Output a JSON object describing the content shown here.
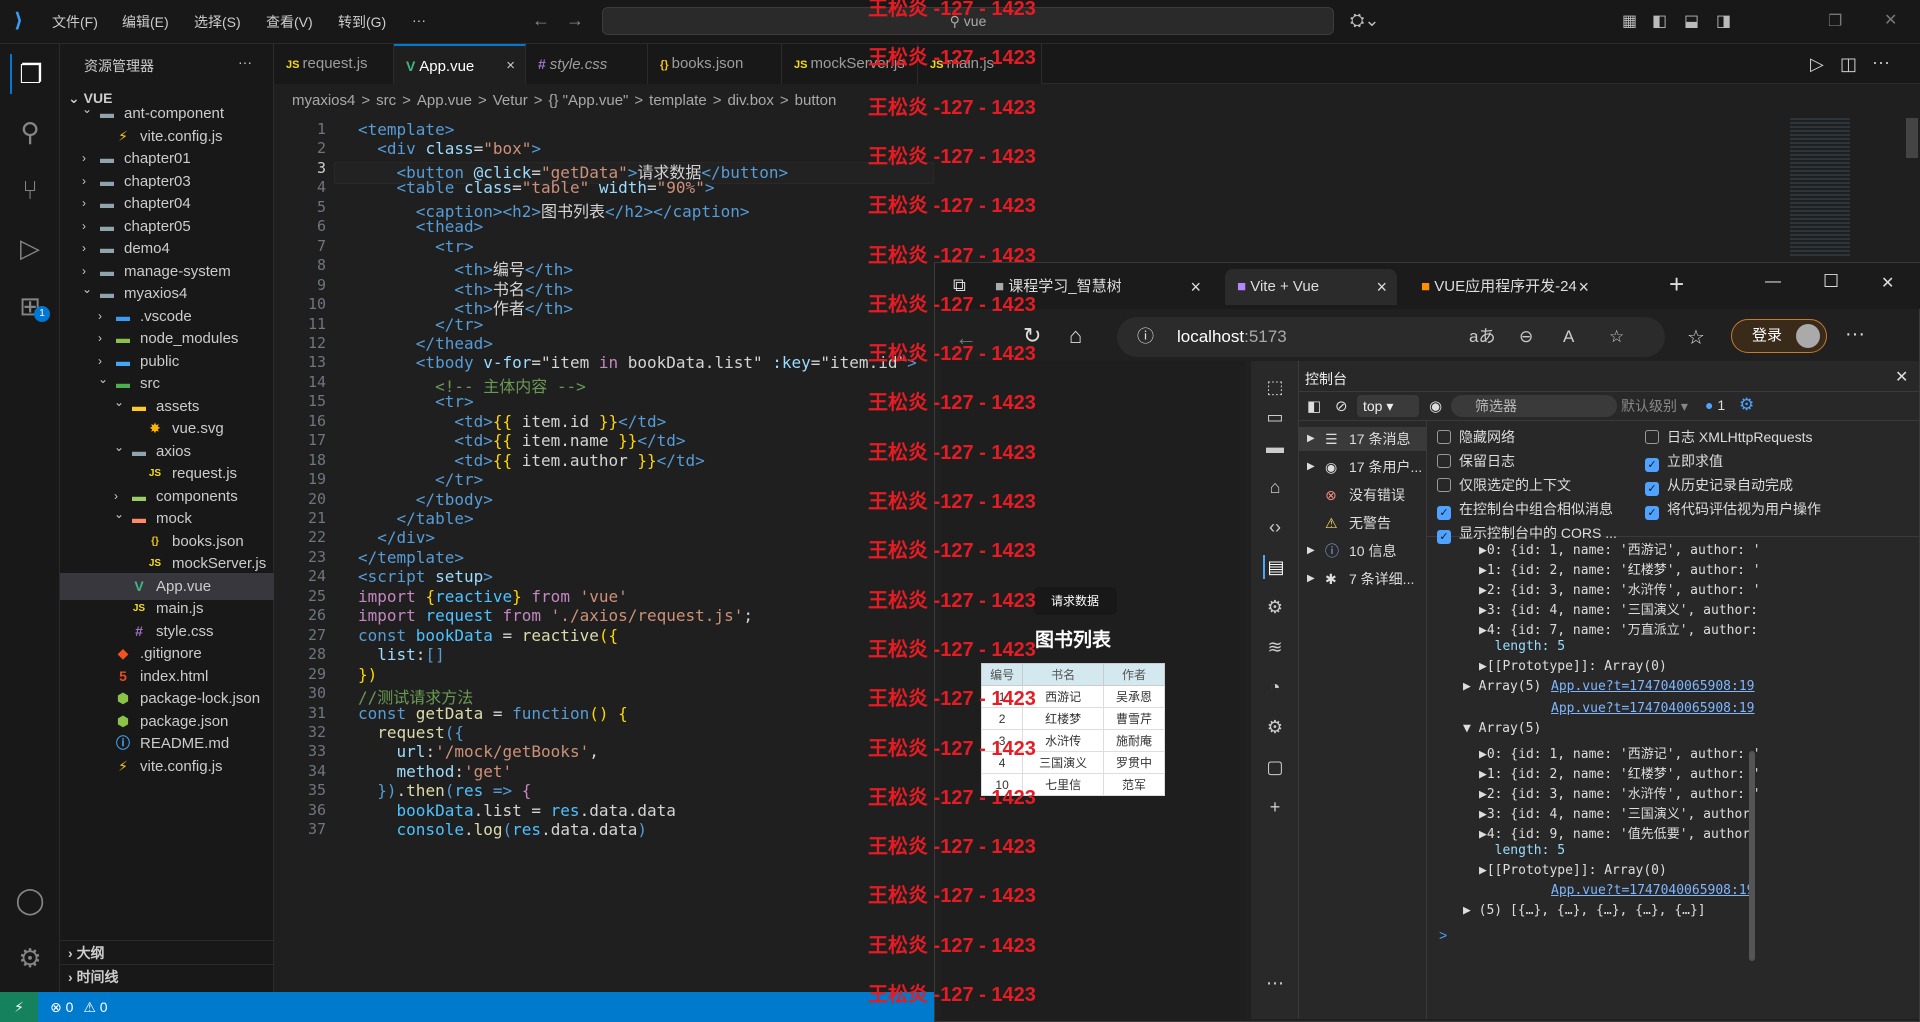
{
  "menu": [
    "文件(F)",
    "编辑(E)",
    "选择(S)",
    "查看(V)",
    "转到(G)",
    "···"
  ],
  "search": "vue",
  "explorer": {
    "title": "资源管理器",
    "more": "···",
    "root": "VUE"
  },
  "tree": [
    {
      "label": "ant-component",
      "depth": 1,
      "type": "folder",
      "open": true,
      "icon": "folder-icon"
    },
    {
      "label": "vite.config.js",
      "depth": 2,
      "type": "file",
      "icon": "vite-file-icon"
    },
    {
      "label": "chapter01",
      "depth": 1,
      "type": "folder",
      "open": false,
      "icon": "folder-icon"
    },
    {
      "label": "chapter03",
      "depth": 1,
      "type": "folder",
      "open": false,
      "icon": "folder-icon"
    },
    {
      "label": "chapter04",
      "depth": 1,
      "type": "folder",
      "open": false,
      "icon": "folder-icon"
    },
    {
      "label": "chapter05",
      "depth": 1,
      "type": "folder",
      "open": false,
      "icon": "folder-icon"
    },
    {
      "label": "demo4",
      "depth": 1,
      "type": "folder",
      "open": false,
      "icon": "folder-icon"
    },
    {
      "label": "manage-system",
      "depth": 1,
      "type": "folder",
      "open": false,
      "icon": "folder-icon"
    },
    {
      "label": "myaxios4",
      "depth": 1,
      "type": "folder",
      "open": true,
      "icon": "folder-icon"
    },
    {
      "label": ".vscode",
      "depth": 2,
      "type": "folder",
      "open": false,
      "icon": "vscode-folder-icon"
    },
    {
      "label": "node_modules",
      "depth": 2,
      "type": "folder",
      "open": false,
      "icon": "node-folder-icon"
    },
    {
      "label": "public",
      "depth": 2,
      "type": "folder",
      "open": false,
      "icon": "public-folder-icon"
    },
    {
      "label": "src",
      "depth": 2,
      "type": "folder",
      "open": true,
      "icon": "src-folder-icon"
    },
    {
      "label": "assets",
      "depth": 3,
      "type": "folder",
      "open": true,
      "icon": "assets-folder-icon"
    },
    {
      "label": "vue.svg",
      "depth": 4,
      "type": "file",
      "icon": "svg-file-icon"
    },
    {
      "label": "axios",
      "depth": 3,
      "type": "folder",
      "open": true,
      "icon": "folder-icon"
    },
    {
      "label": "request.js",
      "depth": 4,
      "type": "file",
      "icon": "js-file-icon"
    },
    {
      "label": "components",
      "depth": 3,
      "type": "folder",
      "open": false,
      "icon": "components-folder-icon"
    },
    {
      "label": "mock",
      "depth": 3,
      "type": "folder",
      "open": true,
      "icon": "mock-folder-icon"
    },
    {
      "label": "books.json",
      "depth": 4,
      "type": "file",
      "icon": "json-file-icon"
    },
    {
      "label": "mockServer.js",
      "depth": 4,
      "type": "file",
      "icon": "js-file-icon"
    },
    {
      "label": "App.vue",
      "depth": 3,
      "type": "file",
      "icon": "vue-file-icon",
      "selected": true
    },
    {
      "label": "main.js",
      "depth": 3,
      "type": "file",
      "icon": "js-file-icon"
    },
    {
      "label": "style.css",
      "depth": 3,
      "type": "file",
      "icon": "css-file-icon"
    },
    {
      "label": ".gitignore",
      "depth": 2,
      "type": "file",
      "icon": "git-file-icon"
    },
    {
      "label": "index.html",
      "depth": 2,
      "type": "file",
      "icon": "html-file-icon"
    },
    {
      "label": "package-lock.json",
      "depth": 2,
      "type": "file",
      "icon": "npm-file-icon"
    },
    {
      "label": "package.json",
      "depth": 2,
      "type": "file",
      "icon": "npm-file-icon"
    },
    {
      "label": "README.md",
      "depth": 2,
      "type": "file",
      "icon": "info-file-icon"
    },
    {
      "label": "vite.config.js",
      "depth": 2,
      "type": "file",
      "icon": "vite-file-icon"
    }
  ],
  "outline": [
    "大纲",
    "时间线"
  ],
  "tabs": [
    {
      "label": "request.js",
      "icon": "js-file-icon"
    },
    {
      "label": "App.vue",
      "icon": "vue-file-icon",
      "active": true,
      "close": "×"
    },
    {
      "label": "style.css",
      "icon": "css-file-icon"
    },
    {
      "label": "books.json",
      "icon": "json-file-icon"
    },
    {
      "label": "mockServer.js",
      "icon": "js-file-icon"
    },
    {
      "label": "main.js",
      "icon": "js-file-icon"
    }
  ],
  "breadcrumb": [
    "myaxios4",
    ">",
    "src",
    ">",
    "App.vue",
    ">",
    "Vetur",
    ">",
    "{} \"App.vue\"",
    ">",
    "template",
    ">",
    "div.box",
    ">",
    "button"
  ],
  "code": [
    [
      [
        "tg",
        "<template>"
      ]
    ],
    [
      [
        "d",
        "  "
      ],
      [
        "tg",
        "<div "
      ],
      [
        "at",
        "class"
      ],
      [
        "d",
        "="
      ],
      [
        "st",
        "\"box\""
      ],
      [
        "tg",
        ">"
      ]
    ],
    [
      [
        "d",
        "    "
      ],
      [
        "tg",
        "<button "
      ],
      [
        "at",
        "@click"
      ],
      [
        "d",
        "="
      ],
      [
        "st",
        "\"getData\""
      ],
      [
        "tg",
        ">"
      ],
      [
        "d",
        "请求数据"
      ],
      [
        "tg",
        "</button>"
      ]
    ],
    [
      [
        "d",
        "    "
      ],
      [
        "tg",
        "<table "
      ],
      [
        "at",
        "class"
      ],
      [
        "d",
        "="
      ],
      [
        "st",
        "\"table\" "
      ],
      [
        "at",
        "width"
      ],
      [
        "d",
        "="
      ],
      [
        "st",
        "\"90%\""
      ],
      [
        "tg",
        ">"
      ]
    ],
    [
      [
        "d",
        "      "
      ],
      [
        "tg",
        "<caption><h2>"
      ],
      [
        "d",
        "图书列表"
      ],
      [
        "tg",
        "</h2></caption>"
      ]
    ],
    [
      [
        "d",
        "      "
      ],
      [
        "tg",
        "<thead>"
      ]
    ],
    [
      [
        "d",
        "        "
      ],
      [
        "tg",
        "<tr>"
      ]
    ],
    [
      [
        "d",
        "          "
      ],
      [
        "tg",
        "<th>"
      ],
      [
        "d",
        "编号"
      ],
      [
        "tg",
        "</th>"
      ]
    ],
    [
      [
        "d",
        "          "
      ],
      [
        "tg",
        "<th>"
      ],
      [
        "d",
        "书名"
      ],
      [
        "tg",
        "</th>"
      ]
    ],
    [
      [
        "d",
        "          "
      ],
      [
        "tg",
        "<th>"
      ],
      [
        "d",
        "作者"
      ],
      [
        "tg",
        "</th>"
      ]
    ],
    [
      [
        "d",
        "        "
      ],
      [
        "tg",
        "</tr>"
      ]
    ],
    [
      [
        "d",
        "      "
      ],
      [
        "tg",
        "</thead>"
      ]
    ],
    [
      [
        "d",
        "      "
      ],
      [
        "tg",
        "<tbody "
      ],
      [
        "at",
        "v-for"
      ],
      [
        "d",
        "=\"item "
      ],
      [
        "kw",
        "in"
      ],
      [
        "d",
        " bookData.list\" "
      ],
      [
        "at",
        ":key"
      ],
      [
        "d",
        "=\"item.id\""
      ],
      [
        "tg",
        ">"
      ]
    ],
    [
      [
        "d",
        "        "
      ],
      [
        "cm",
        "<!-- 主体内容 -->"
      ]
    ],
    [
      [
        "d",
        "        "
      ],
      [
        "tg",
        "<tr>"
      ]
    ],
    [
      [
        "d",
        "          "
      ],
      [
        "tg",
        "<td>"
      ],
      [
        "br",
        "{{"
      ],
      [
        "d",
        " item.id "
      ],
      [
        "br",
        "}}"
      ],
      [
        "tg",
        "</td>"
      ]
    ],
    [
      [
        "d",
        "          "
      ],
      [
        "tg",
        "<td>"
      ],
      [
        "br",
        "{{"
      ],
      [
        "d",
        " item.name "
      ],
      [
        "br",
        "}}"
      ],
      [
        "tg",
        "</td>"
      ]
    ],
    [
      [
        "d",
        "          "
      ],
      [
        "tg",
        "<td>"
      ],
      [
        "br",
        "{{"
      ],
      [
        "d",
        " item.author "
      ],
      [
        "br",
        "}}"
      ],
      [
        "tg",
        "</td>"
      ]
    ],
    [
      [
        "d",
        "        "
      ],
      [
        "tg",
        "</tr>"
      ]
    ],
    [
      [
        "d",
        "      "
      ],
      [
        "tg",
        "</tbody>"
      ]
    ],
    [
      [
        "d",
        "    "
      ],
      [
        "tg",
        "</table>"
      ]
    ],
    [
      [
        "d",
        "  "
      ],
      [
        "tg",
        "</div>"
      ]
    ],
    [
      [
        "tg",
        "</template>"
      ]
    ],
    [
      [
        "tg",
        "<script "
      ],
      [
        "at",
        "setup"
      ],
      [
        "tg",
        ">"
      ]
    ],
    [
      [
        "kw",
        "import "
      ],
      [
        "br",
        "{"
      ],
      [
        "vr",
        "reactive"
      ],
      [
        "br",
        "}"
      ],
      [
        "kw",
        " from "
      ],
      [
        "st",
        "'vue'"
      ]
    ],
    [
      [
        "kw",
        "import "
      ],
      [
        "vr",
        "request"
      ],
      [
        "kw",
        " from "
      ],
      [
        "st",
        "'./axios/request.js'"
      ],
      [
        "d",
        ";"
      ]
    ],
    [
      [
        "tg",
        "const "
      ],
      [
        "vr",
        "bookData"
      ],
      [
        "d",
        " = "
      ],
      [
        "fn",
        "reactive"
      ],
      [
        "br",
        "({"
      ]
    ],
    [
      [
        "d",
        "  "
      ],
      [
        "at",
        "list"
      ],
      [
        "d",
        ":"
      ],
      [
        "tg",
        "[]"
      ]
    ],
    [
      [
        "br",
        "})"
      ]
    ],
    [
      [
        "cm",
        "//测试请求方法"
      ]
    ],
    [
      [
        "tg",
        "const "
      ],
      [
        "fn",
        "getData"
      ],
      [
        "d",
        " = "
      ],
      [
        "tg",
        "function"
      ],
      [
        "br",
        "() {"
      ]
    ],
    [
      [
        "d",
        "  "
      ],
      [
        "fn",
        "request"
      ],
      [
        "tg",
        "({"
      ]
    ],
    [
      [
        "d",
        "    "
      ],
      [
        "at",
        "url"
      ],
      [
        "d",
        ":"
      ],
      [
        "st",
        "'/mock/getBooks'"
      ],
      [
        "d",
        ","
      ]
    ],
    [
      [
        "d",
        "    "
      ],
      [
        "at",
        "method"
      ],
      [
        "d",
        ":"
      ],
      [
        "st",
        "'get'"
      ]
    ],
    [
      [
        "d",
        "  "
      ],
      [
        "tg",
        "})"
      ],
      [
        "d",
        "."
      ],
      [
        "fn",
        "then"
      ],
      [
        "tg",
        "("
      ],
      [
        "vr",
        "res"
      ],
      [
        "tg",
        " => "
      ],
      [
        "kw",
        "{"
      ]
    ],
    [
      [
        "d",
        "    "
      ],
      [
        "vr",
        "bookData"
      ],
      [
        "d",
        ".list = "
      ],
      [
        "vr",
        "res"
      ],
      [
        "d",
        ".data.data"
      ]
    ],
    [
      [
        "d",
        "    "
      ],
      [
        "vr",
        "console"
      ],
      [
        "d",
        "."
      ],
      [
        "fn",
        "log"
      ],
      [
        "tg",
        "("
      ],
      [
        "vr",
        "res"
      ],
      [
        "d",
        ".data.data"
      ],
      [
        "tg",
        ")"
      ]
    ]
  ],
  "watermark": "王松炎 -127 - 1423",
  "browser": {
    "tabs": [
      {
        "label": "课程学习_智慧树",
        "close": "×"
      },
      {
        "label": "Vite + Vue",
        "close": "×",
        "active": true
      },
      {
        "label": "VUE应用程序开发-24",
        "close": "×"
      }
    ],
    "new_tab": "+",
    "url_host": "localhost",
    "url_port": ":5173",
    "login": "登录",
    "window_controls": [
      "—",
      "☐",
      "✕"
    ]
  },
  "app": {
    "button": "请求数据",
    "caption": "图书列表",
    "headers": [
      "编号",
      "书名",
      "作者"
    ],
    "rows": [
      [
        "1",
        "西游记",
        "吴承恩"
      ],
      [
        "2",
        "红楼梦",
        "曹雪芹"
      ],
      [
        "3",
        "水浒传",
        "施耐庵"
      ],
      [
        "4",
        "三国演义",
        "罗贯中"
      ],
      [
        "10",
        "七里信",
        "范军"
      ]
    ]
  },
  "devtools": {
    "title": "控制台",
    "context": "top",
    "filter_placeholder": "筛选器",
    "level": "默认级别",
    "issues": "1",
    "sidebar": [
      {
        "label": "17 条消息",
        "icon": "list-icon",
        "expandable": true
      },
      {
        "label": "17 条用户...",
        "icon": "user-icon",
        "expandable": true
      },
      {
        "label": "没有错误",
        "icon": "error-icon",
        "expandable": false
      },
      {
        "label": "无警告",
        "icon": "warning-icon",
        "expandable": false
      },
      {
        "label": "10 信息",
        "icon": "info-icon",
        "expandable": true
      },
      {
        "label": "7 条详细...",
        "icon": "bug-icon",
        "expandable": true
      }
    ],
    "settings": [
      {
        "label": "隐藏网络",
        "checked": false
      },
      {
        "label": "日志 XMLHttpRequests",
        "checked": false
      },
      {
        "label": "保留日志",
        "checked": false
      },
      {
        "label": "立即求值",
        "checked": true
      },
      {
        "label": "仅限选定的上下文",
        "checked": false
      },
      {
        "label": "从历史记录自动完成",
        "checked": true
      },
      {
        "label": "在控制台中组合相似消息",
        "checked": true
      },
      {
        "label": "将代码评估视为用户操作",
        "checked": true
      },
      {
        "label": "显示控制台中的 CORS ...",
        "checked": true
      }
    ],
    "console": [
      {
        "kind": "line",
        "text": "▶0: {id: 1, name: '西游记', author: '"
      },
      {
        "kind": "line",
        "text": "▶1: {id: 2, name: '红楼梦', author: '"
      },
      {
        "kind": "line",
        "text": "▶2: {id: 3, name: '水浒传', author: '"
      },
      {
        "kind": "line",
        "text": "▶3: {id: 4, name: '三国演义', author:"
      },
      {
        "kind": "line",
        "text": "▶4: {id: 7, name: '万直派立', author:"
      },
      {
        "kind": "line",
        "text": "  length: 5"
      },
      {
        "kind": "line",
        "text": "▶[[Prototype]]: Array(0)"
      },
      {
        "kind": "head",
        "text": "▶ Array(5)",
        "link": "App.vue?t=1747040065908:19"
      },
      {
        "kind": "link",
        "link": "App.vue?t=1747040065908:19"
      },
      {
        "kind": "head",
        "text": "▼ Array(5)",
        "link": ""
      },
      {
        "kind": "line",
        "text": "▶0: {id: 1, name: '西游记', author: '"
      },
      {
        "kind": "line",
        "text": "▶1: {id: 2, name: '红楼梦', author: '"
      },
      {
        "kind": "line",
        "text": "▶2: {id: 3, name: '水浒传', author: '"
      },
      {
        "kind": "line",
        "text": "▶3: {id: 4, name: '三国演义', author:"
      },
      {
        "kind": "line",
        "text": "▶4: {id: 9, name: '值先低要', author:"
      },
      {
        "kind": "line",
        "text": "  length: 5"
      },
      {
        "kind": "line",
        "text": "▶[[Prototype]]: Array(0)"
      },
      {
        "kind": "link",
        "link": "App.vue?t=1747040065908:19"
      },
      {
        "kind": "head",
        "text": "▶ (5) [{…}, {…}, {…}, {…}, {…}]",
        "link": ""
      }
    ],
    "prompt": ">"
  },
  "status": {
    "remote": "⚡",
    "errors": "0",
    "warnings": "0"
  }
}
